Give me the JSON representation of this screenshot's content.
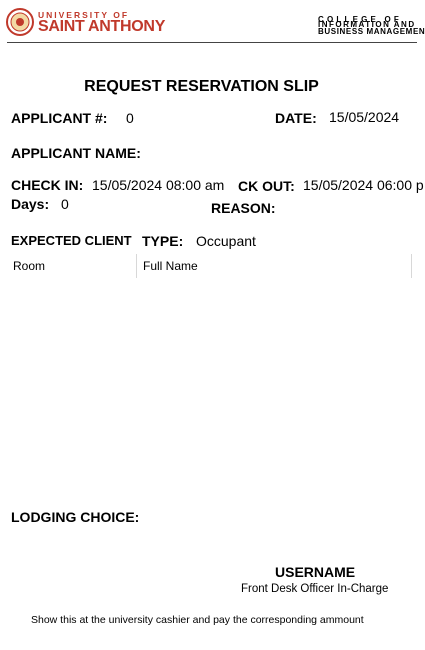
{
  "header": {
    "university_top": "UNIVERSITY OF",
    "university_name": "SAINT ANTHONY",
    "college_line1": "COLLEGE OF",
    "college_line2": "INFORMATION AND",
    "college_line3": "BUSINESS MANAGEMENT"
  },
  "title": "REQUEST RESERVATION SLIP",
  "applicant": {
    "label": "APPLICANT #:",
    "value": "0"
  },
  "date": {
    "label": "DATE:",
    "value": "15/05/2024"
  },
  "applicant_name": {
    "label": "APPLICANT NAME:",
    "value": ""
  },
  "check_in": {
    "label": "CHECK IN:",
    "value": "15/05/2024 08:00 am"
  },
  "check_out": {
    "label": "CK OUT:",
    "value": "15/05/2024 06:00 p"
  },
  "days": {
    "label": "Days:",
    "value": "0"
  },
  "reason": {
    "label": "REASON:",
    "value": ""
  },
  "expected_client": {
    "label": "EXPECTED CLIENT"
  },
  "type": {
    "label": "TYPE:",
    "value": "Occupant"
  },
  "table": {
    "columns": [
      "Room",
      "Full Name"
    ]
  },
  "lodging_choice": {
    "label": "LODGING CHOICE:",
    "value": ""
  },
  "officer": {
    "username": "USERNAME",
    "role": "Front Desk Officer In-Charge"
  },
  "footer_note": "Show this at the university cashier and pay the corresponding ammount",
  "colors": {
    "brand": "#c0392b"
  }
}
